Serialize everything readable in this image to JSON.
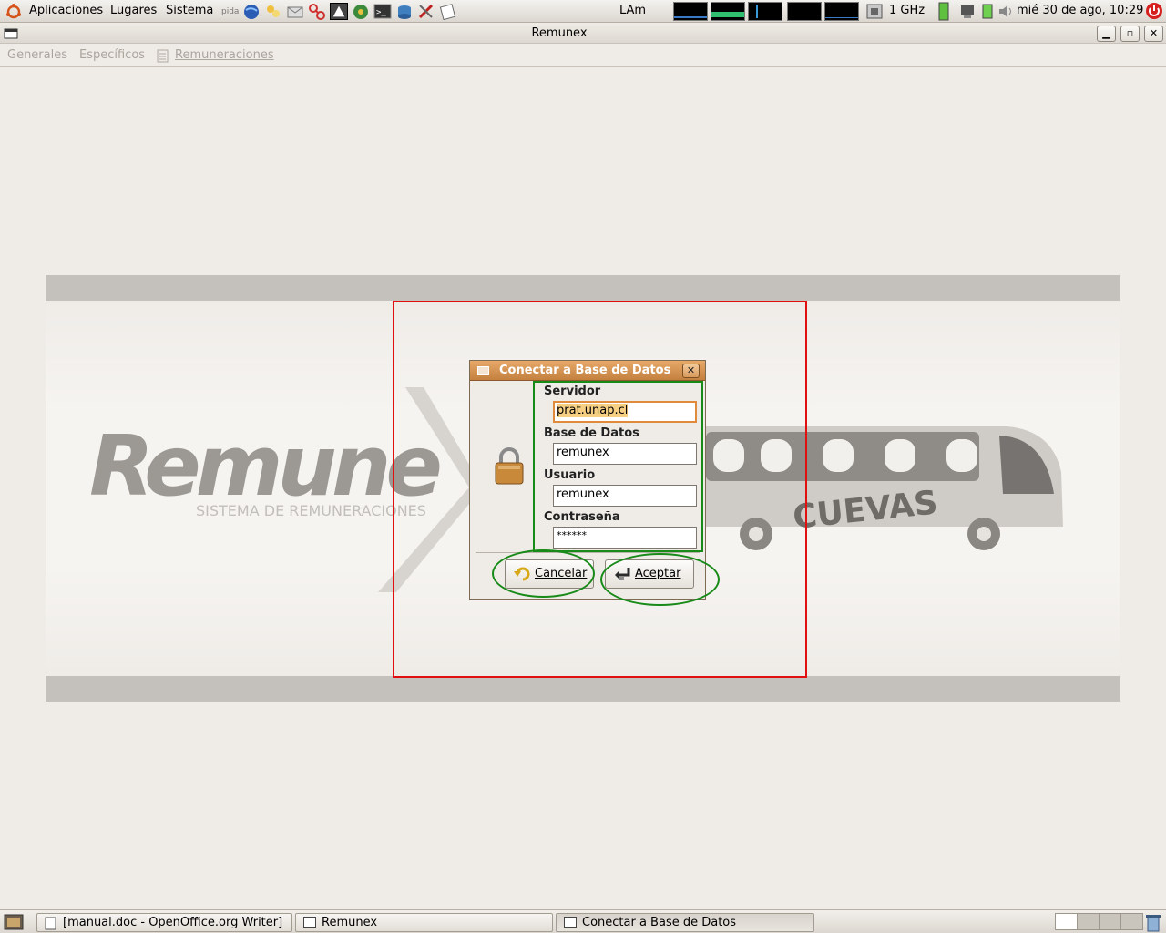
{
  "top_panel": {
    "menus": [
      "Aplicaciones",
      "Lugares",
      "Sistema"
    ],
    "status_text": "LAm",
    "cpu_freq": "1 GHz",
    "datetime": "mié 30 de ago, 10:29"
  },
  "window": {
    "title": "Remunex",
    "menubar": [
      "Generales",
      "Específicos",
      "Remuneraciones"
    ]
  },
  "splash": {
    "logo_word": "Remune",
    "logo_subtitle": "SISTEMA DE REMUNERACIONES",
    "bus_text": "CUEVAS"
  },
  "dialog": {
    "title": "Conectar a Base de Datos",
    "server_label": "Servidor",
    "server_value": "prat.unap.cl",
    "database_label": "Base de Datos",
    "database_value": "remunex",
    "user_label": "Usuario",
    "user_value": "remunex",
    "password_label": "Contraseña",
    "password_value": "******",
    "cancel_label": "Cancelar",
    "accept_label": "Aceptar"
  },
  "taskbar": {
    "tasks": [
      "[manual.doc - OpenOffice.org Writer]",
      "Remunex",
      "Conectar a Base de Datos"
    ]
  },
  "colors": {
    "annotation_red": "#e01010",
    "annotation_green": "#188a18",
    "dialog_titlebar": "#d08c4a"
  }
}
